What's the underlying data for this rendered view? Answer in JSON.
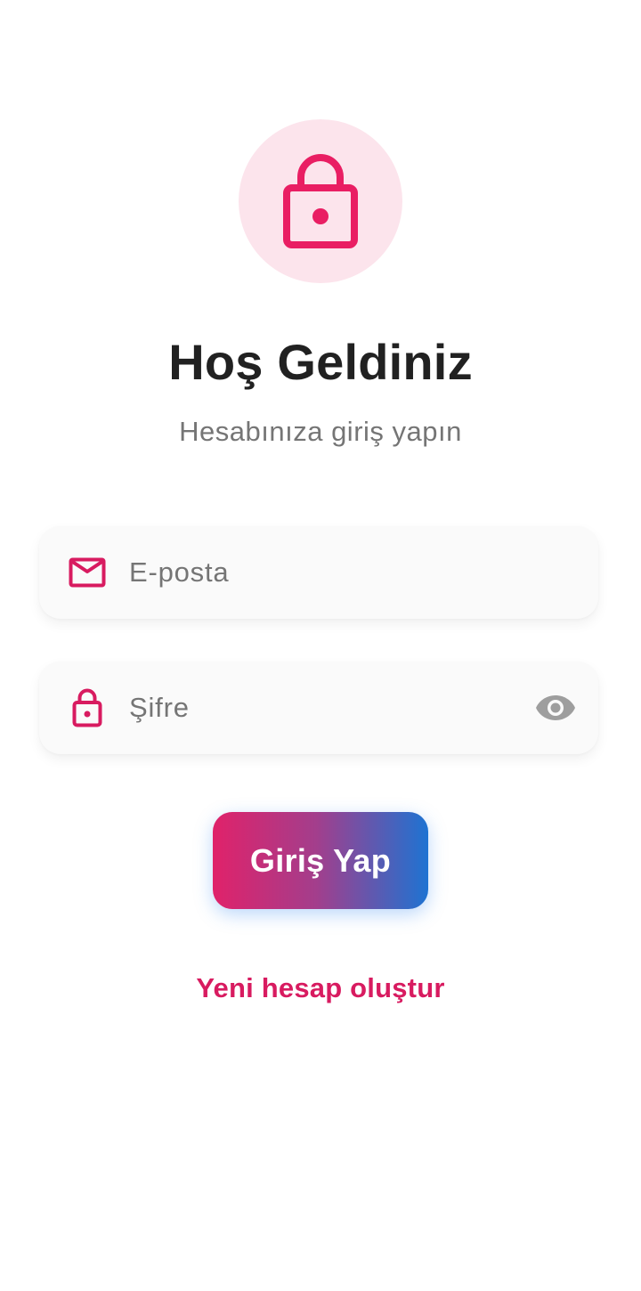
{
  "header": {
    "logo_icon": "lock-icon",
    "title": "Hoş Geldiniz",
    "subtitle": "Hesabınıza giriş yapın"
  },
  "form": {
    "email": {
      "icon": "mail-icon",
      "placeholder": "E-posta",
      "value": ""
    },
    "password": {
      "icon": "lock-icon",
      "placeholder": "Şifre",
      "value": "",
      "toggle_icon": "eye-icon"
    },
    "submit_label": "Giriş Yap"
  },
  "footer": {
    "register_label": "Yeni hesap oluştur"
  },
  "colors": {
    "accent": "#d81b60",
    "logo_bg": "#fce4ec",
    "button_gradient_start": "#e0226a",
    "button_gradient_end": "#1e73d2",
    "title_text": "#212121",
    "muted_text": "#757575"
  }
}
